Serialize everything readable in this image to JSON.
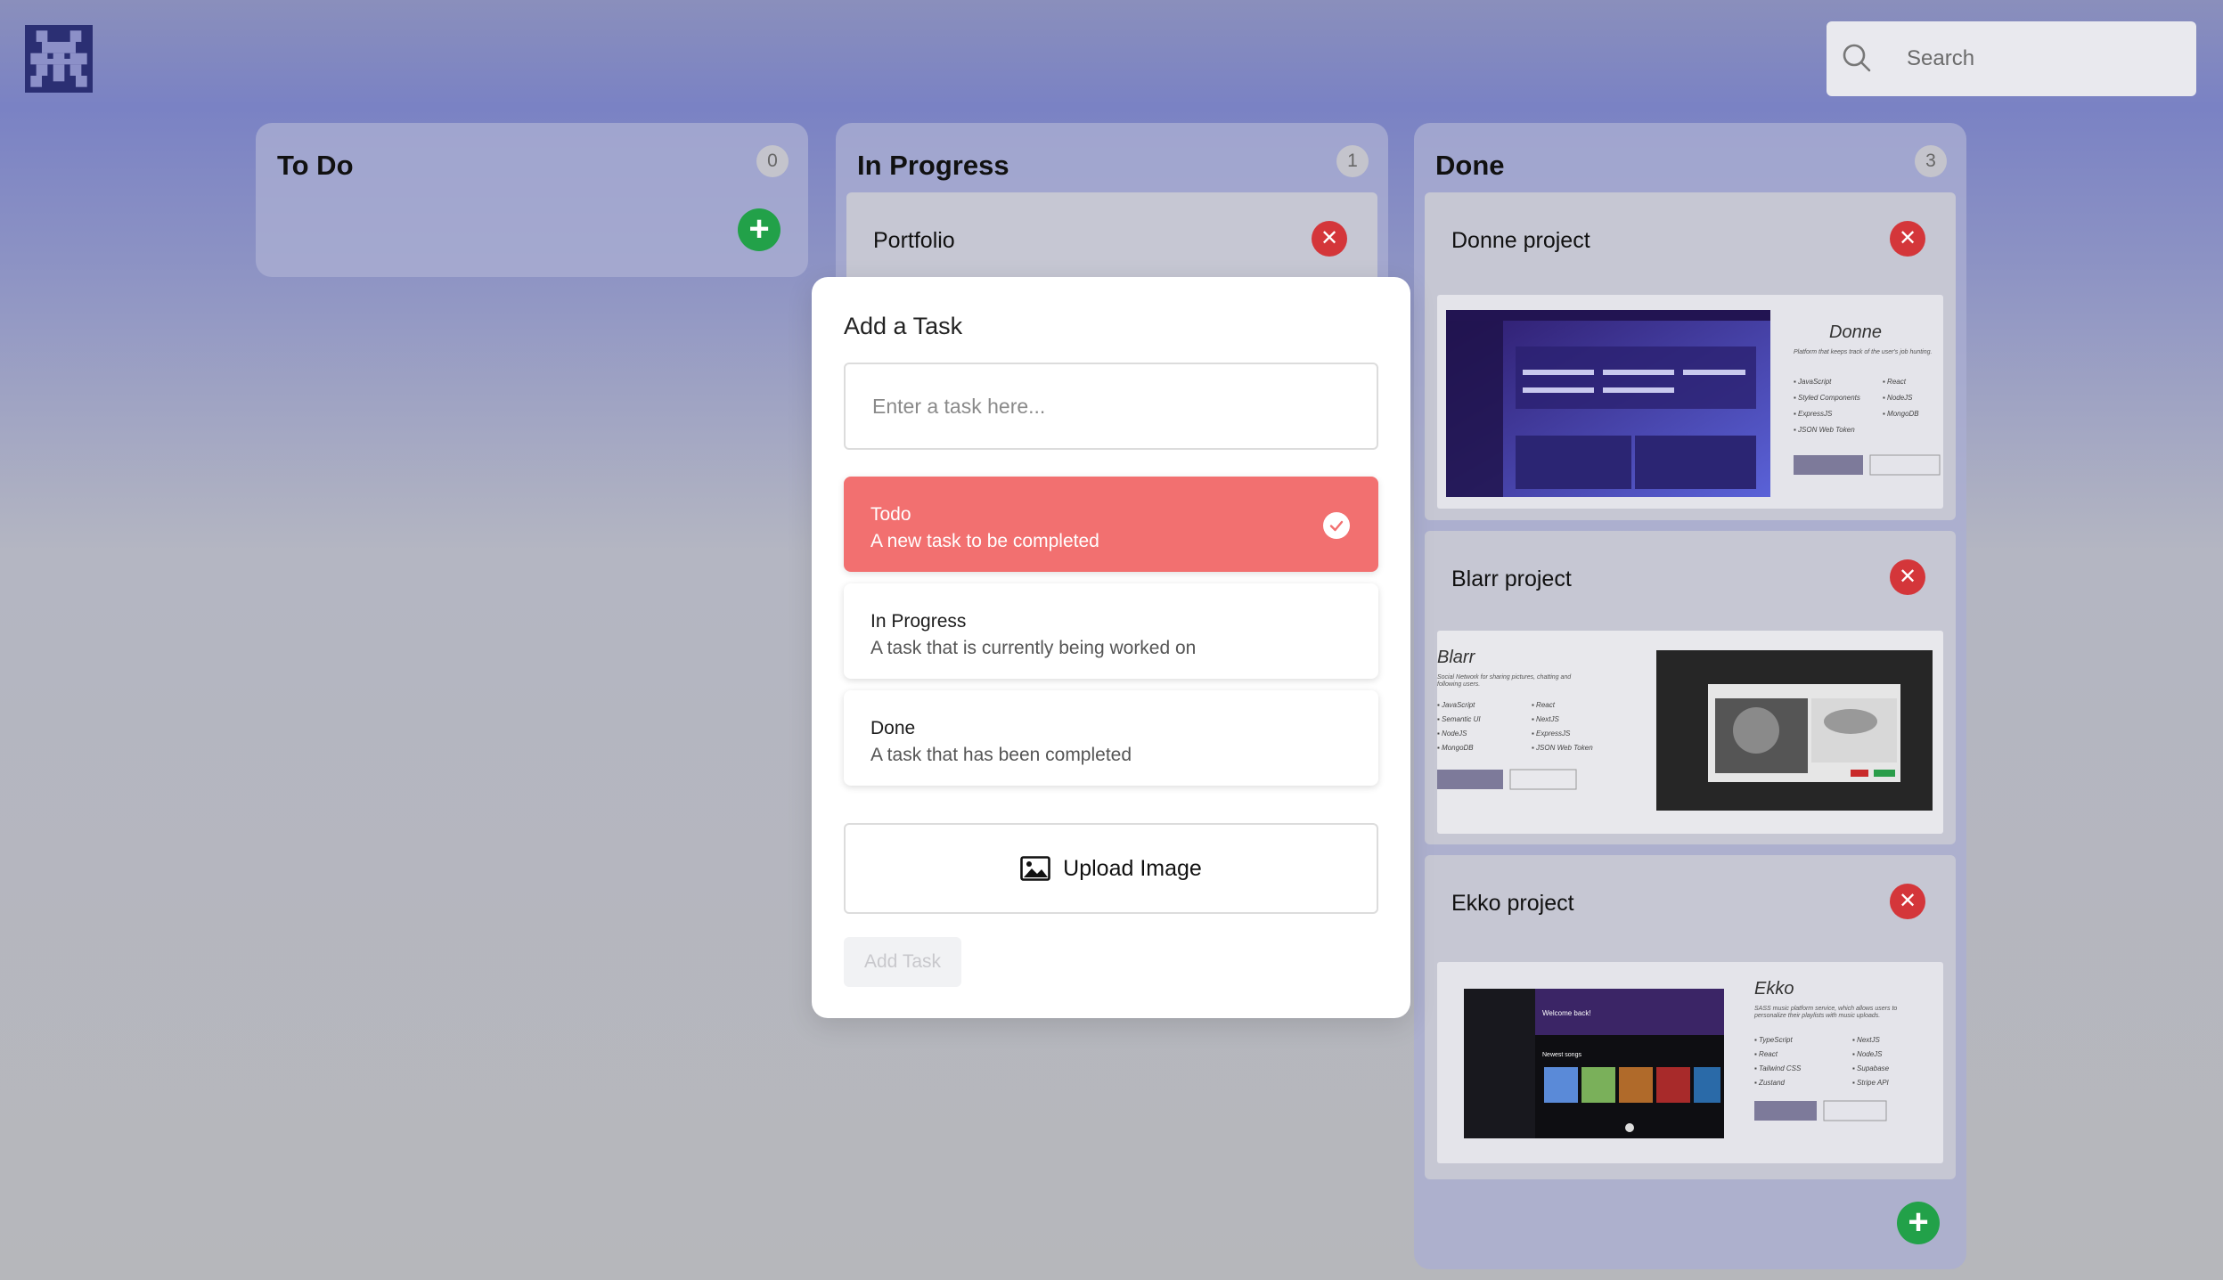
{
  "search": {
    "placeholder": "Search"
  },
  "columns": [
    {
      "title": "To Do",
      "count": "0"
    },
    {
      "title": "In Progress",
      "count": "1"
    },
    {
      "title": "Done",
      "count": "3"
    }
  ],
  "in_progress_cards": [
    {
      "title": "Portfolio"
    }
  ],
  "done_cards": [
    {
      "title": "Donne project",
      "thumb_title": "Donne",
      "thumb_desc": "Platform that keeps track of the user's job hunting."
    },
    {
      "title": "Blarr project",
      "thumb_title": "Blarr",
      "thumb_desc": "Social Network for sharing pictures, chatting and following users."
    },
    {
      "title": "Ekko project",
      "thumb_title": "Ekko",
      "thumb_desc": "SASS music platform service, which allows users to personalize their playlists with music uploads."
    }
  ],
  "modal": {
    "title": "Add a Task",
    "input_placeholder": "Enter a task here...",
    "options": [
      {
        "name": "Todo",
        "desc": "A new task to be completed",
        "selected": true
      },
      {
        "name": "In Progress",
        "desc": "A task that is currently being worked on",
        "selected": false
      },
      {
        "name": "Done",
        "desc": "A task that has been completed",
        "selected": false
      }
    ],
    "upload_label": "Upload Image",
    "submit_label": "Add Task"
  },
  "colors": {
    "accent_selected": "#f27070",
    "add_button": "#22a149",
    "delete_button": "#d4363a"
  }
}
